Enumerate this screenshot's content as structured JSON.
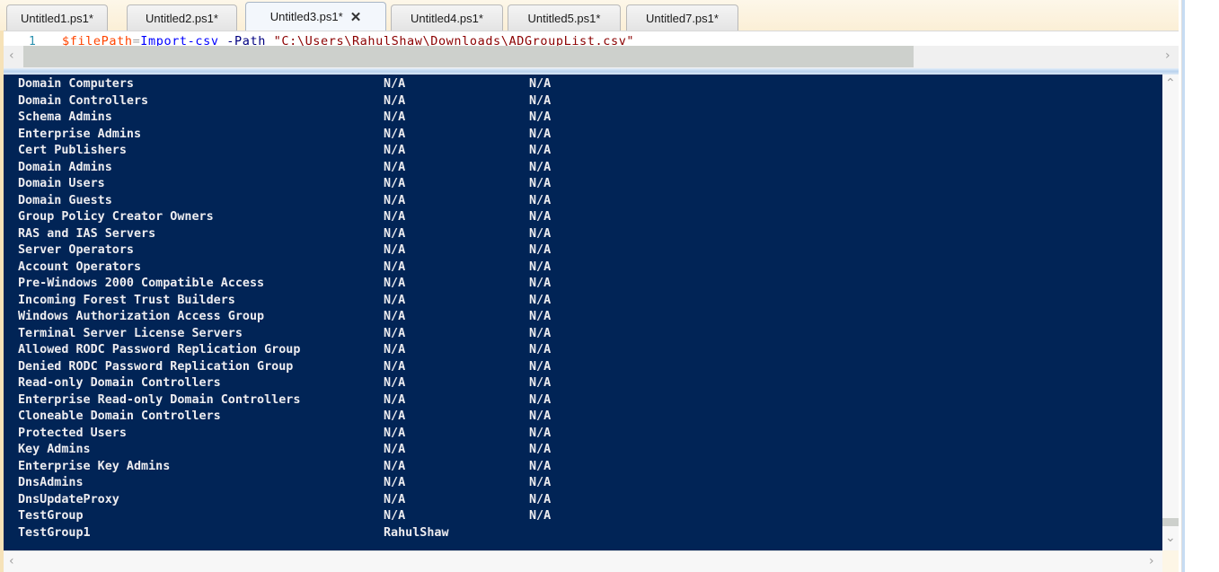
{
  "tabs": [
    {
      "label": "Untitled1.ps1*",
      "active": false
    },
    {
      "label": "Untitled2.ps1*",
      "active": false
    },
    {
      "label": "Untitled3.ps1*",
      "active": true
    },
    {
      "label": "Untitled4.ps1*",
      "active": false
    },
    {
      "label": "Untitled5.ps1*",
      "active": false
    },
    {
      "label": "Untitled7.ps1*",
      "active": false
    }
  ],
  "tab_close_glyph": "✕",
  "collapse_glyph": "⌃",
  "editor": {
    "line_number": "1",
    "code_tokens": {
      "var": "$filePath",
      "op": "=",
      "cmd": "Import-csv",
      "param": " -Path ",
      "str": "\"C:\\Users\\RahulShaw\\Downloads\\ADGroupList.csv\""
    }
  },
  "scroll_glyphs": {
    "left": "‹",
    "right": "›",
    "up": "⌃",
    "down": "⌄"
  },
  "console": {
    "rows": [
      {
        "name": "Domain Computers",
        "col_b": "N/A",
        "col_c": "N/A"
      },
      {
        "name": "Domain Controllers",
        "col_b": "N/A",
        "col_c": "N/A"
      },
      {
        "name": "Schema Admins",
        "col_b": "N/A",
        "col_c": "N/A"
      },
      {
        "name": "Enterprise Admins",
        "col_b": "N/A",
        "col_c": "N/A"
      },
      {
        "name": "Cert Publishers",
        "col_b": "N/A",
        "col_c": "N/A"
      },
      {
        "name": "Domain Admins",
        "col_b": "N/A",
        "col_c": "N/A"
      },
      {
        "name": "Domain Users",
        "col_b": "N/A",
        "col_c": "N/A"
      },
      {
        "name": "Domain Guests",
        "col_b": "N/A",
        "col_c": "N/A"
      },
      {
        "name": "Group Policy Creator Owners",
        "col_b": "N/A",
        "col_c": "N/A"
      },
      {
        "name": "RAS and IAS Servers",
        "col_b": "N/A",
        "col_c": "N/A"
      },
      {
        "name": "Server Operators",
        "col_b": "N/A",
        "col_c": "N/A"
      },
      {
        "name": "Account Operators",
        "col_b": "N/A",
        "col_c": "N/A"
      },
      {
        "name": "Pre-Windows 2000 Compatible Access",
        "col_b": "N/A",
        "col_c": "N/A"
      },
      {
        "name": "Incoming Forest Trust Builders",
        "col_b": "N/A",
        "col_c": "N/A"
      },
      {
        "name": "Windows Authorization Access Group",
        "col_b": "N/A",
        "col_c": "N/A"
      },
      {
        "name": "Terminal Server License Servers",
        "col_b": "N/A",
        "col_c": "N/A"
      },
      {
        "name": "Allowed RODC Password Replication Group",
        "col_b": "N/A",
        "col_c": "N/A"
      },
      {
        "name": "Denied RODC Password Replication Group",
        "col_b": "N/A",
        "col_c": "N/A"
      },
      {
        "name": "Read-only Domain Controllers",
        "col_b": "N/A",
        "col_c": "N/A"
      },
      {
        "name": "Enterprise Read-only Domain Controllers",
        "col_b": "N/A",
        "col_c": "N/A"
      },
      {
        "name": "Cloneable Domain Controllers",
        "col_b": "N/A",
        "col_c": "N/A"
      },
      {
        "name": "Protected Users",
        "col_b": "N/A",
        "col_c": "N/A"
      },
      {
        "name": "Key Admins",
        "col_b": "N/A",
        "col_c": "N/A"
      },
      {
        "name": "Enterprise Key Admins",
        "col_b": "N/A",
        "col_c": "N/A"
      },
      {
        "name": "DnsAdmins",
        "col_b": "N/A",
        "col_c": "N/A"
      },
      {
        "name": "DnsUpdateProxy",
        "col_b": "N/A",
        "col_c": "N/A"
      },
      {
        "name": "TestGroup",
        "col_b": "N/A",
        "col_c": "N/A"
      },
      {
        "name": "TestGroup1",
        "col_b": "RahulShaw",
        "col_c": ""
      }
    ]
  },
  "colors": {
    "console_bg": "#012456",
    "console_fg": "#eeedf0",
    "active_tab_bg": "#f3f7fc"
  }
}
